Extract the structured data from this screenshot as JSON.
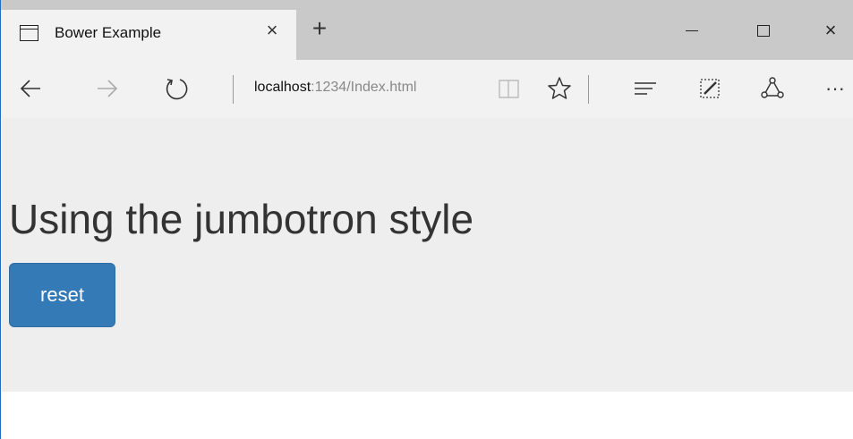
{
  "browser": {
    "tab": {
      "title": "Bower Example",
      "icon": "page-icon",
      "close_glyph": "×"
    },
    "new_tab_glyph": "+",
    "window_controls": {
      "minimize_icon": "minimize-icon",
      "maximize_icon": "maximize-icon",
      "close_glyph": "×"
    },
    "nav": {
      "back_icon": "back-arrow-icon",
      "forward_icon": "forward-arrow-icon",
      "refresh_icon": "refresh-icon",
      "url_host": "localhost",
      "url_path": ":1234/Index.html",
      "reading_view_icon": "reading-view-icon",
      "favorite_icon": "star-icon",
      "hub_icon": "hub-icon",
      "web_note_icon": "web-note-icon",
      "share_icon": "share-icon",
      "more_glyph": "···"
    }
  },
  "page": {
    "heading": "Using the jumbotron style",
    "reset_label": "reset",
    "colors": {
      "jumbotron_bg": "#eeeeee",
      "button_bg": "#337ab7",
      "button_text": "#ffffff",
      "heading_text": "#333333"
    }
  }
}
